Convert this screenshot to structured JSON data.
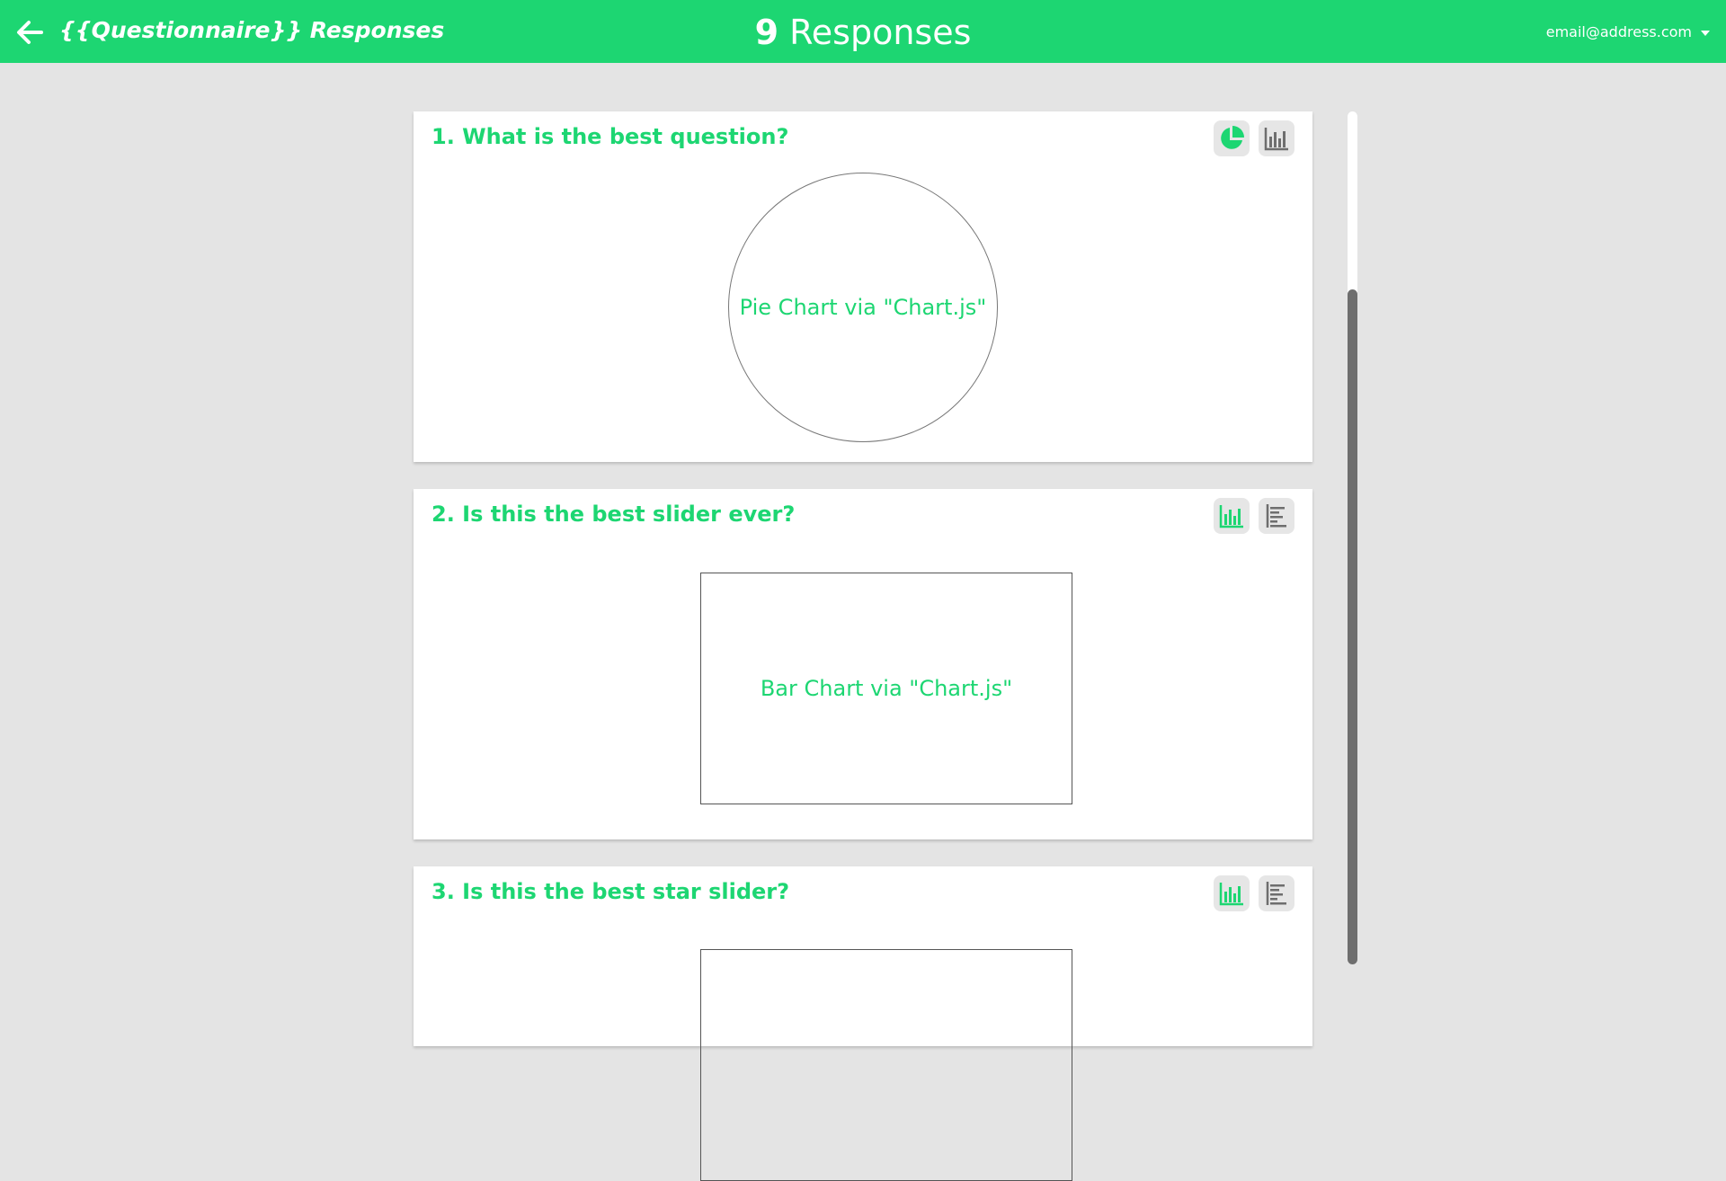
{
  "header": {
    "title": "{{Questionnaire}} Responses",
    "responses_count": "9",
    "responses_label": "Responses",
    "user_email": "email@address.com"
  },
  "colors": {
    "accent": "#1dd672",
    "background": "#e4e4e4",
    "icon_inactive": "#6e6e6e",
    "button_bg": "#e6e6e6"
  },
  "questions": [
    {
      "title": "1. What is the best question?",
      "chart_placeholder": "Pie Chart via \"Chart.js\"",
      "view_buttons": [
        {
          "icon": "pie-chart-icon",
          "active": true
        },
        {
          "icon": "bar-chart-icon",
          "active": false
        }
      ]
    },
    {
      "title": "2. Is this the best slider ever?",
      "chart_placeholder": "Bar Chart via \"Chart.js\"",
      "view_buttons": [
        {
          "icon": "bar-chart-icon",
          "active": true
        },
        {
          "icon": "horizontal-bar-chart-icon",
          "active": false
        }
      ]
    },
    {
      "title": "3. Is this the best star slider?",
      "chart_placeholder": "",
      "view_buttons": [
        {
          "icon": "bar-chart-icon",
          "active": true
        },
        {
          "icon": "horizontal-bar-chart-icon",
          "active": false
        }
      ]
    }
  ]
}
